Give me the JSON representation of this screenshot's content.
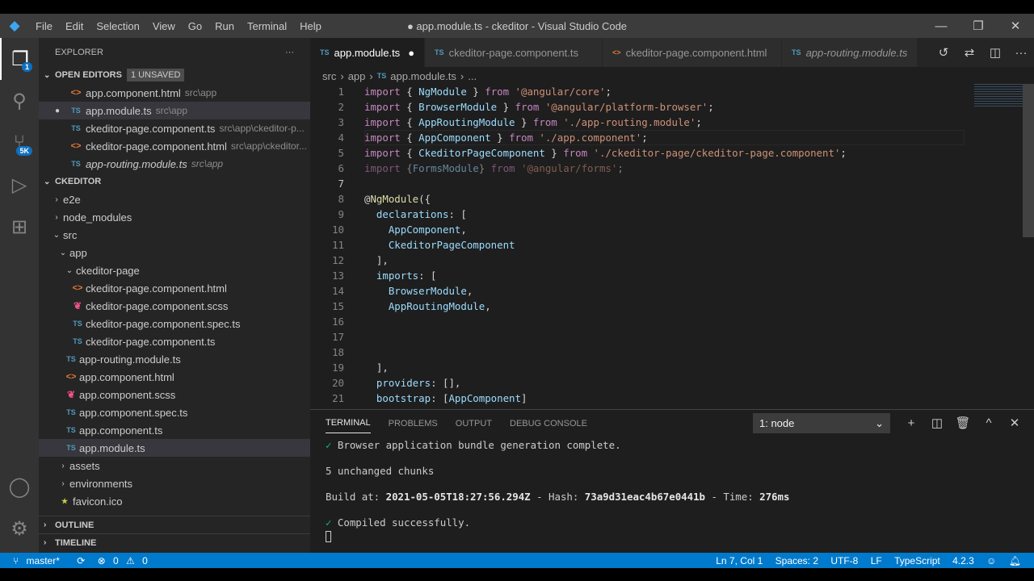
{
  "window": {
    "title": "● app.module.ts - ckeditor - Visual Studio Code",
    "menu": [
      "File",
      "Edit",
      "Selection",
      "View",
      "Go",
      "Run",
      "Terminal",
      "Help"
    ]
  },
  "activity": {
    "explorer_badge": "1",
    "scm_badge": "5K"
  },
  "sidebar": {
    "title": "EXPLORER",
    "open_editors": {
      "label": "OPEN EDITORS",
      "badge": "1 UNSAVED",
      "items": [
        {
          "name": "app.component.html",
          "path": "src\\app",
          "type": "html"
        },
        {
          "name": "app.module.ts",
          "path": "src\\app",
          "type": "ts"
        },
        {
          "name": "ckeditor-page.component.ts",
          "path": "src\\app\\ckeditor-p...",
          "type": "ts"
        },
        {
          "name": "ckeditor-page.component.html",
          "path": "src\\app\\ckeditor...",
          "type": "html"
        },
        {
          "name": "app-routing.module.ts",
          "path": "src\\app",
          "type": "ts"
        }
      ]
    },
    "project": {
      "label": "CKEDITOR",
      "tree": [
        {
          "name": "e2e"
        },
        {
          "name": "node_modules"
        },
        {
          "name": "src"
        },
        {
          "name": "app"
        },
        {
          "name": "ckeditor-page"
        },
        {
          "name": "ckeditor-page.component.html"
        },
        {
          "name": "ckeditor-page.component.scss"
        },
        {
          "name": "ckeditor-page.component.spec.ts"
        },
        {
          "name": "ckeditor-page.component.ts"
        },
        {
          "name": "app-routing.module.ts"
        },
        {
          "name": "app.component.html"
        },
        {
          "name": "app.component.scss"
        },
        {
          "name": "app.component.spec.ts"
        },
        {
          "name": "app.component.ts"
        },
        {
          "name": "app.module.ts"
        },
        {
          "name": "assets"
        },
        {
          "name": "environments"
        },
        {
          "name": "favicon.ico"
        }
      ]
    },
    "outline": "OUTLINE",
    "timeline": "TIMELINE"
  },
  "tabs": [
    {
      "label": "app.module.ts",
      "icon": "TS"
    },
    {
      "label": "ckeditor-page.component.ts",
      "icon": "TS"
    },
    {
      "label": "ckeditor-page.component.html",
      "icon": "<>"
    },
    {
      "label": "app-routing.module.ts",
      "icon": "TS"
    }
  ],
  "breadcrumb": [
    "src",
    "app",
    "app.module.ts",
    "..."
  ],
  "code": [
    "import { NgModule } from '@angular/core';",
    "import { BrowserModule } from '@angular/platform-browser';",
    "import { AppRoutingModule } from './app-routing.module';",
    "import { AppComponent } from './app.component';",
    "import { CkeditorPageComponent } from './ckeditor-page/ckeditor-page.component';",
    "import {FormsModule} from '@angular/forms';",
    "",
    "@NgModule({",
    "  declarations: [",
    "    AppComponent,",
    "    CkeditorPageComponent",
    "  ],",
    "  imports: [",
    "    BrowserModule,",
    "    AppRoutingModule,",
    "",
    "",
    "",
    "  ],",
    "  providers: [],",
    "  bootstrap: [AppComponent]"
  ],
  "panel": {
    "tabs": [
      "TERMINAL",
      "PROBLEMS",
      "OUTPUT",
      "DEBUG CONSOLE"
    ],
    "terminal_select": "1: node",
    "lines": {
      "l1": "Browser application bundle generation complete.",
      "l2": "5 unchanged chunks",
      "build_label": "Build at: ",
      "build_time": "2021-05-05T18:27:56.294Z",
      "hash_label": " - Hash: ",
      "hash": "73a9d31eac4b67e0441b",
      "time_label": " - Time: ",
      "time": "276ms",
      "l4": "Compiled successfully."
    }
  },
  "status": {
    "branch": "master*",
    "errors": "0",
    "warnings": "0",
    "position": "Ln 7, Col 1",
    "spaces": "Spaces: 2",
    "encoding": "UTF-8",
    "eol": "LF",
    "language": "TypeScript",
    "version": "4.2.3"
  }
}
